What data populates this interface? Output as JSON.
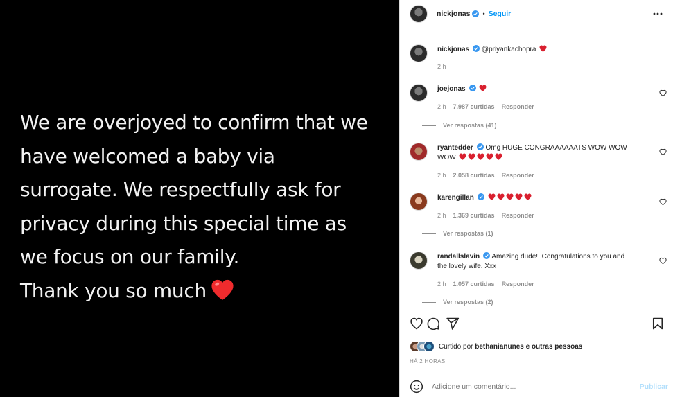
{
  "media": {
    "lines": [
      "We are overjoyed to confirm that we",
      "have welcomed a baby via",
      "surrogate. We respectfully ask for",
      "privacy during this special time as",
      "we focus on our family.",
      "Thank you so much"
    ]
  },
  "header": {
    "username": "nickjonas",
    "dot": "•",
    "follow_label": "Seguir"
  },
  "caption": {
    "username": "nickjonas",
    "text": "@priyankachopra",
    "time": "2 h"
  },
  "comments": [
    {
      "username": "joejonas",
      "text": "",
      "hearts": 1,
      "time": "2 h",
      "likes": "7.987 curtidas",
      "reply": "Responder",
      "replies": "Ver respostas (41)"
    },
    {
      "username": "ryantedder",
      "text": "Omg HUGE CONGRAAAAAATS WOW WOW",
      "text2": "WOW",
      "hearts": 5,
      "time": "2 h",
      "likes": "2.058 curtidas",
      "reply": "Responder",
      "replies": ""
    },
    {
      "username": "karengillan",
      "text": "",
      "hearts": 5,
      "time": "2 h",
      "likes": "1.369 curtidas",
      "reply": "Responder",
      "replies": "Ver respostas (1)"
    },
    {
      "username": "randallslavin",
      "text": "Amazing dude!! Congratulations to you and",
      "text2": "the lovely wife. Xxx",
      "hearts": 0,
      "time": "2 h",
      "likes": "1.057 curtidas",
      "reply": "Responder",
      "replies": "Ver respostas (2)"
    }
  ],
  "footer": {
    "liked_by_prefix": "Curtido por",
    "liked_by_user": "bethanianunes",
    "liked_by_suffix": "e outras pessoas",
    "ago": "HÁ 2 HORAS",
    "add_placeholder": "Adicione um comentário...",
    "publish_label": "Publicar"
  },
  "colors": {
    "accent": "#0095f6",
    "heart_red": "#ed4956",
    "verified": "#3897f0"
  }
}
